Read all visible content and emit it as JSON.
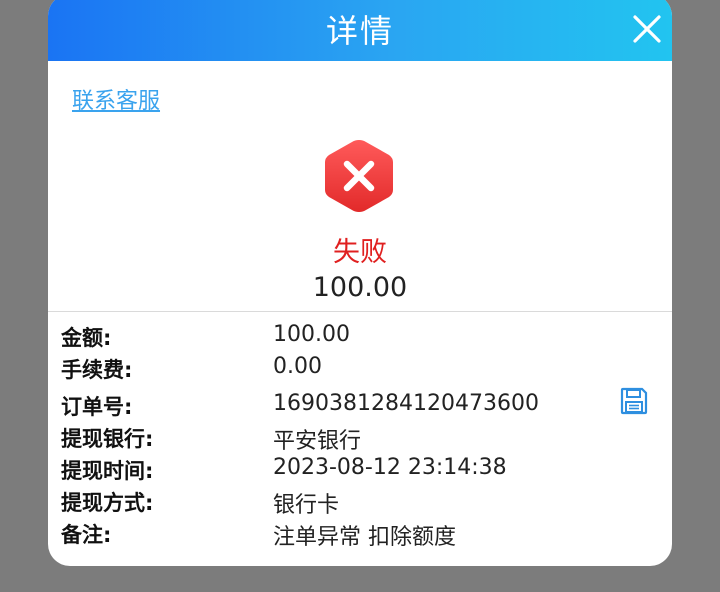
{
  "dialog": {
    "title": "详情",
    "contact_link": "联系客服"
  },
  "status": {
    "label": "失败",
    "amount": "100.00",
    "icon": "error-x-icon",
    "color": "#e02020"
  },
  "details": [
    {
      "label": "金额:",
      "value": "100.00"
    },
    {
      "label": "手续费:",
      "value": "0.00"
    },
    {
      "label": "订单号:",
      "value": "1690381284120473600"
    },
    {
      "label": "提现银行:",
      "value": "平安银行"
    },
    {
      "label": "提现时间:",
      "value": "2023-08-12 23:14:38"
    },
    {
      "label": "提现方式:",
      "value": "银行卡"
    },
    {
      "label": "备注:",
      "value": "注单异常 扣除额度"
    }
  ],
  "colors": {
    "header_start": "#1a74f3",
    "header_end": "#22c4f0",
    "link": "#3aa3ee",
    "failure": "#e02020",
    "overlay": "#7c7c7c"
  }
}
